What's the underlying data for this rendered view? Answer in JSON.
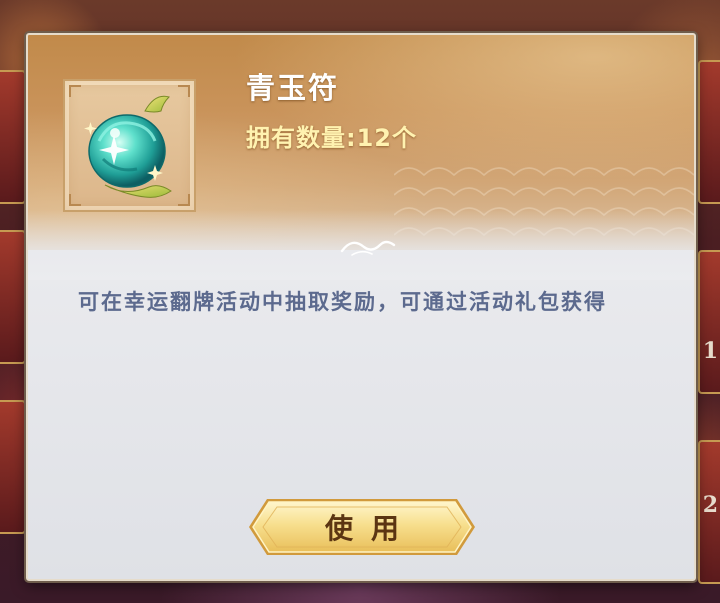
{
  "item": {
    "name": "青玉符",
    "count_label": "拥有数量:",
    "count_value": "12个",
    "icon": "jade-orb-icon",
    "description": "可在幸运翻牌活动中抽取奖励，可通过活动礼包获得"
  },
  "actions": {
    "use_label": "使用"
  },
  "background": {
    "peek_text_1": "1",
    "peek_text_2": "2"
  },
  "colors": {
    "header": "#c9935a",
    "body": "#e9eaee",
    "name_text": "#ffffff",
    "count_text": "#fff2b0",
    "description_text": "#5c6a8e",
    "button_gold": "#f6de8a",
    "button_text": "#5b3512"
  }
}
